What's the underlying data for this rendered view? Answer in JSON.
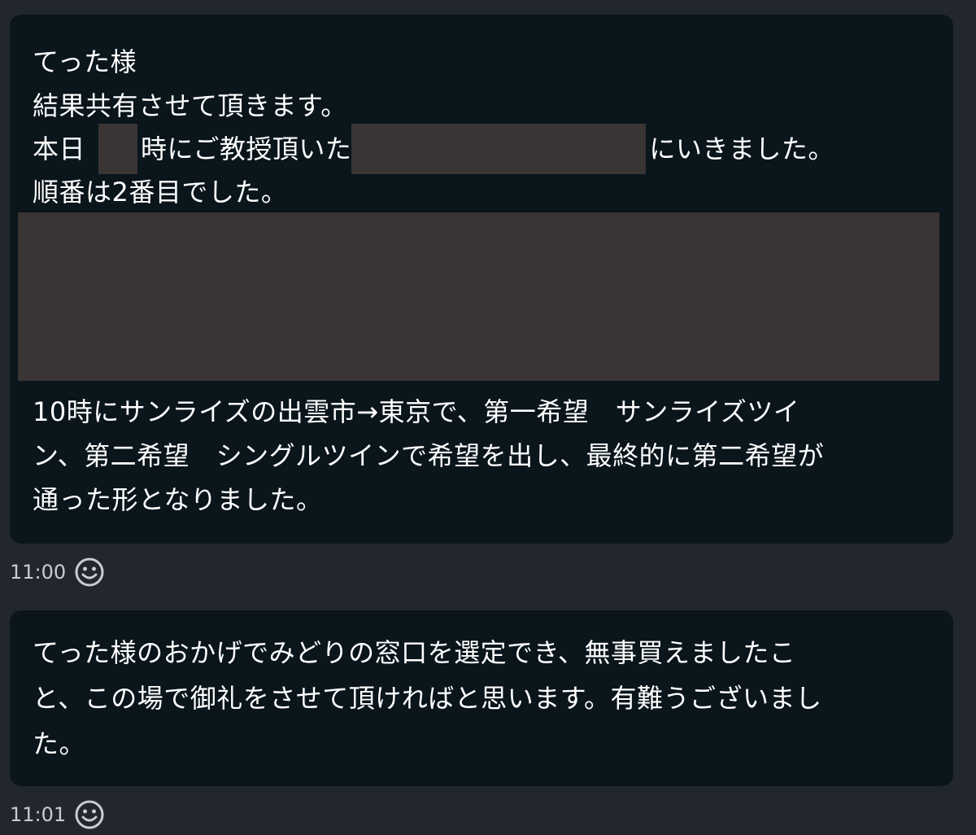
{
  "messages": [
    {
      "lines": {
        "l1": "てった様",
        "l2": "結果共有させて頂きます。",
        "l3a": "本日",
        "l3b": "時にご教授頂いた",
        "l3c": "にいきました。",
        "l4": "順番は2番目でした。",
        "l5": "10時にサンライズの出雲市→東京で、第一希望　サンライズツイ",
        "l6": "ン、第二希望　シングルツインで希望を出し、最終的に第二希望が",
        "l7": "通った形となりました。"
      },
      "time": "11:00",
      "reaction_icon": "smiley-icon"
    },
    {
      "lines": {
        "l1": "てった様のおかげでみどりの窓口を選定でき、無事買えましたこ",
        "l2": "と、この場で御礼をさせて頂ければと思います。有難うございまし",
        "l3": "た。"
      },
      "time": "11:01",
      "reaction_icon": "smiley-icon"
    }
  ],
  "colors": {
    "background": "#22272e",
    "bubble": "#0a151c",
    "redaction": "#3a3434",
    "text": "#ffffff",
    "meta_text": "#c7cdd3"
  }
}
